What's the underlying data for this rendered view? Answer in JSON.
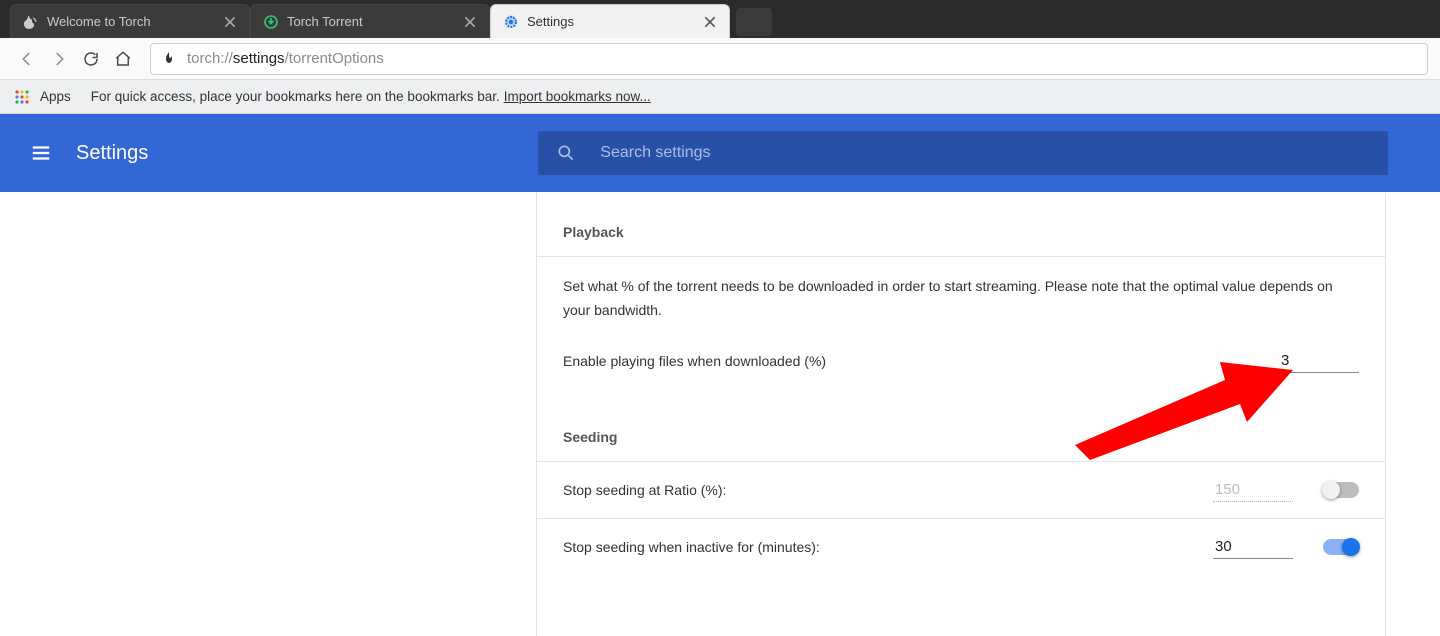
{
  "tabs": [
    {
      "title": "Welcome to Torch",
      "active": false
    },
    {
      "title": "Torch Torrent",
      "active": false
    },
    {
      "title": "Settings",
      "active": true
    }
  ],
  "url": {
    "prefix": "torch://",
    "bold": "settings",
    "suffix": "/torrentOptions"
  },
  "bookmarks_bar": {
    "apps_label": "Apps",
    "hint": "For quick access, place your bookmarks here on the bookmarks bar.",
    "link": "Import bookmarks now..."
  },
  "header": {
    "title": "Settings",
    "search_placeholder": "Search settings"
  },
  "sections": {
    "playback": {
      "title": "Playback",
      "desc": "Set what % of the torrent needs to be downloaded in order to start streaming. Please note that the optimal value depends on your bandwidth.",
      "row_label": "Enable playing files when downloaded (%)",
      "value": "3"
    },
    "seeding": {
      "title": "Seeding",
      "ratio_label": "Stop seeding at Ratio (%):",
      "ratio_value": "150",
      "ratio_enabled": false,
      "inactive_label": "Stop seeding when inactive for (minutes):",
      "inactive_value": "30",
      "inactive_enabled": true
    }
  }
}
